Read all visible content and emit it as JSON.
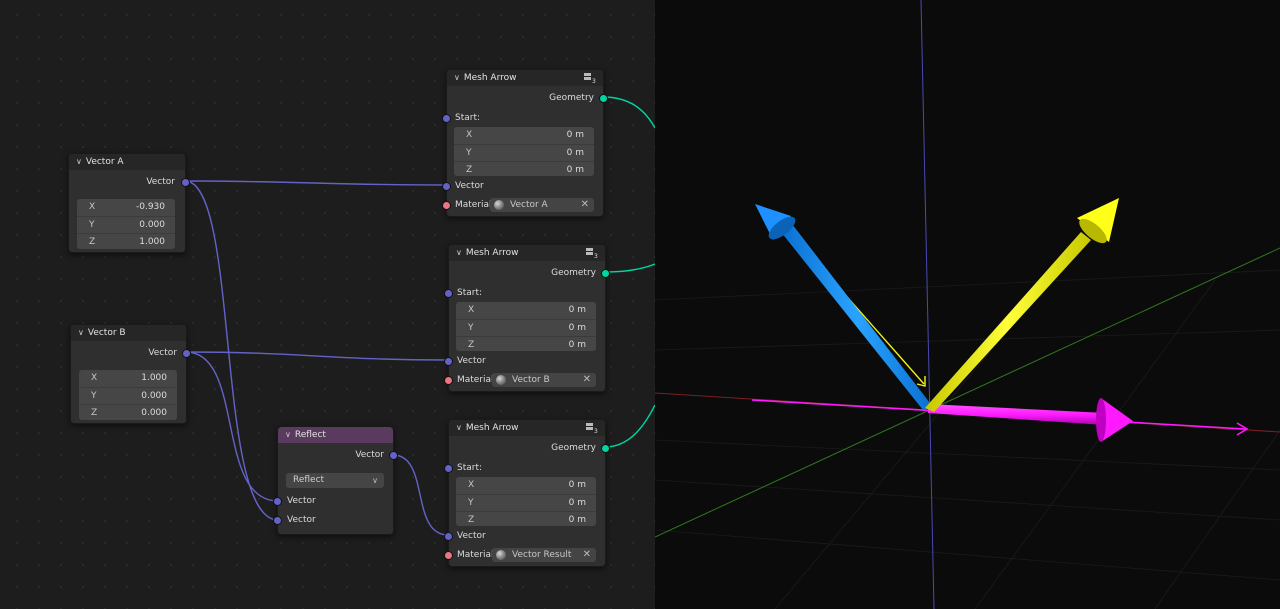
{
  "node_editor": {
    "vector_a": {
      "title": "Vector A",
      "output_label": "Vector",
      "fields": [
        {
          "label": "X",
          "value": "-0.930"
        },
        {
          "label": "Y",
          "value": "0.000"
        },
        {
          "label": "Z",
          "value": "1.000"
        }
      ]
    },
    "vector_b": {
      "title": "Vector B",
      "output_label": "Vector",
      "fields": [
        {
          "label": "X",
          "value": "1.000"
        },
        {
          "label": "Y",
          "value": "0.000"
        },
        {
          "label": "Z",
          "value": "0.000"
        }
      ]
    },
    "reflect": {
      "title": "Reflect",
      "output_label": "Vector",
      "operation": "Reflect",
      "input1_label": "Vector",
      "input2_label": "Vector"
    },
    "mesh_arrows": [
      {
        "title": "Mesh Arrow",
        "user_count": "3",
        "output_label": "Geometry",
        "start_label": "Start:",
        "fields": [
          {
            "label": "X",
            "value": "0 m"
          },
          {
            "label": "Y",
            "value": "0 m"
          },
          {
            "label": "Z",
            "value": "0 m"
          }
        ],
        "vector_label": "Vector",
        "material_label": "Material:",
        "material_name": "Vector A"
      },
      {
        "title": "Mesh Arrow",
        "user_count": "3",
        "output_label": "Geometry",
        "start_label": "Start:",
        "fields": [
          {
            "label": "X",
            "value": "0 m"
          },
          {
            "label": "Y",
            "value": "0 m"
          },
          {
            "label": "Z",
            "value": "0 m"
          }
        ],
        "vector_label": "Vector",
        "material_label": "Material:",
        "material_name": "Vector B"
      },
      {
        "title": "Mesh Arrow",
        "user_count": "3",
        "output_label": "Geometry",
        "start_label": "Start:",
        "fields": [
          {
            "label": "X",
            "value": "0 m"
          },
          {
            "label": "Y",
            "value": "0 m"
          },
          {
            "label": "Z",
            "value": "0 m"
          }
        ],
        "vector_label": "Vector",
        "material_label": "Material:",
        "material_name": "Vector Result"
      }
    ]
  },
  "colors": {
    "vector_socket": "#6363c7",
    "geometry_socket": "#00d6a3",
    "material_socket": "#eb7582",
    "reflect_header": "#5a3a5e",
    "arrow_vector_a": "#1e90ff",
    "arrow_vector_result": "#f5f516",
    "arrow_vector_b": "#ff19ff",
    "axis_x": "#7a2020",
    "axis_y": "#2f7a1f",
    "axis_z": "#4a4ab0"
  }
}
